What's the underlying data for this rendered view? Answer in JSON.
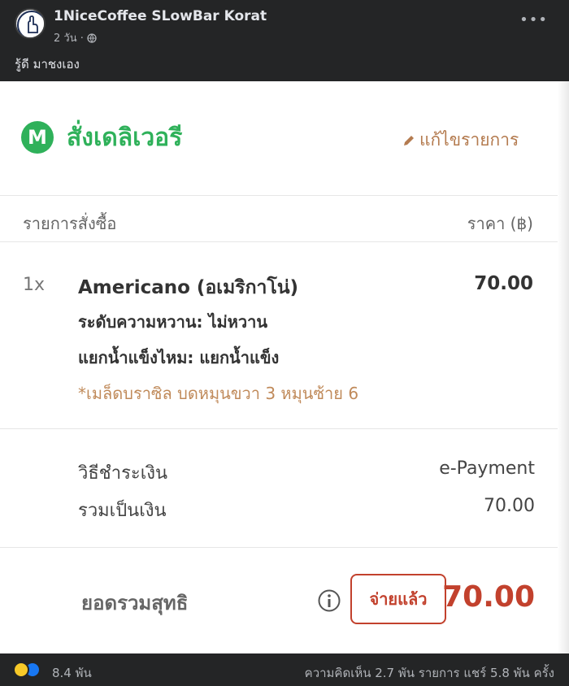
{
  "post": {
    "page_name": "1NiceCoffee SLowBar Korat",
    "time": "2 วัน ·",
    "caption": "รู้ดี มาชงเอง"
  },
  "receipt": {
    "title": "สั่งเดลิเวอรี",
    "logo_letter": "M",
    "edit_label": "แก้ไขรายการ",
    "header": {
      "item_col": "รายการสั่งซื้อ",
      "price_col": "ราคา (฿)"
    },
    "item": {
      "qty": "1x",
      "name": "Americano (อเมริกาโน่)",
      "price": "70.00",
      "option1": "ระดับความหวาน: ไม่หวาน",
      "option2": "แยกน้ำแข็งไหม: แยกน้ำแข็ง",
      "note": "*เมล็ดบราซิล บดหมุนขวา 3 หมุนซ้าย 6"
    },
    "payment": {
      "method_label": "วิธีชำระเงิน",
      "method_value": "e-Payment",
      "subtotal_label": "รวมเป็นเงิน",
      "subtotal_value": "70.00"
    },
    "total": {
      "label": "ยอดรวมสุทธิ",
      "paid_badge": "จ่ายแล้ว",
      "amount": "70.00"
    }
  },
  "footer": {
    "reaction_count": "8.4 พัน",
    "stats": "ความคิดเห็น 2.7 พัน รายการ แชร์ 5.8 พัน ครั้ง"
  },
  "colors": {
    "green": "#2fb15a",
    "accent_brown": "#b47b4f",
    "red": "#c2412d",
    "fb_dark": "#242526"
  }
}
